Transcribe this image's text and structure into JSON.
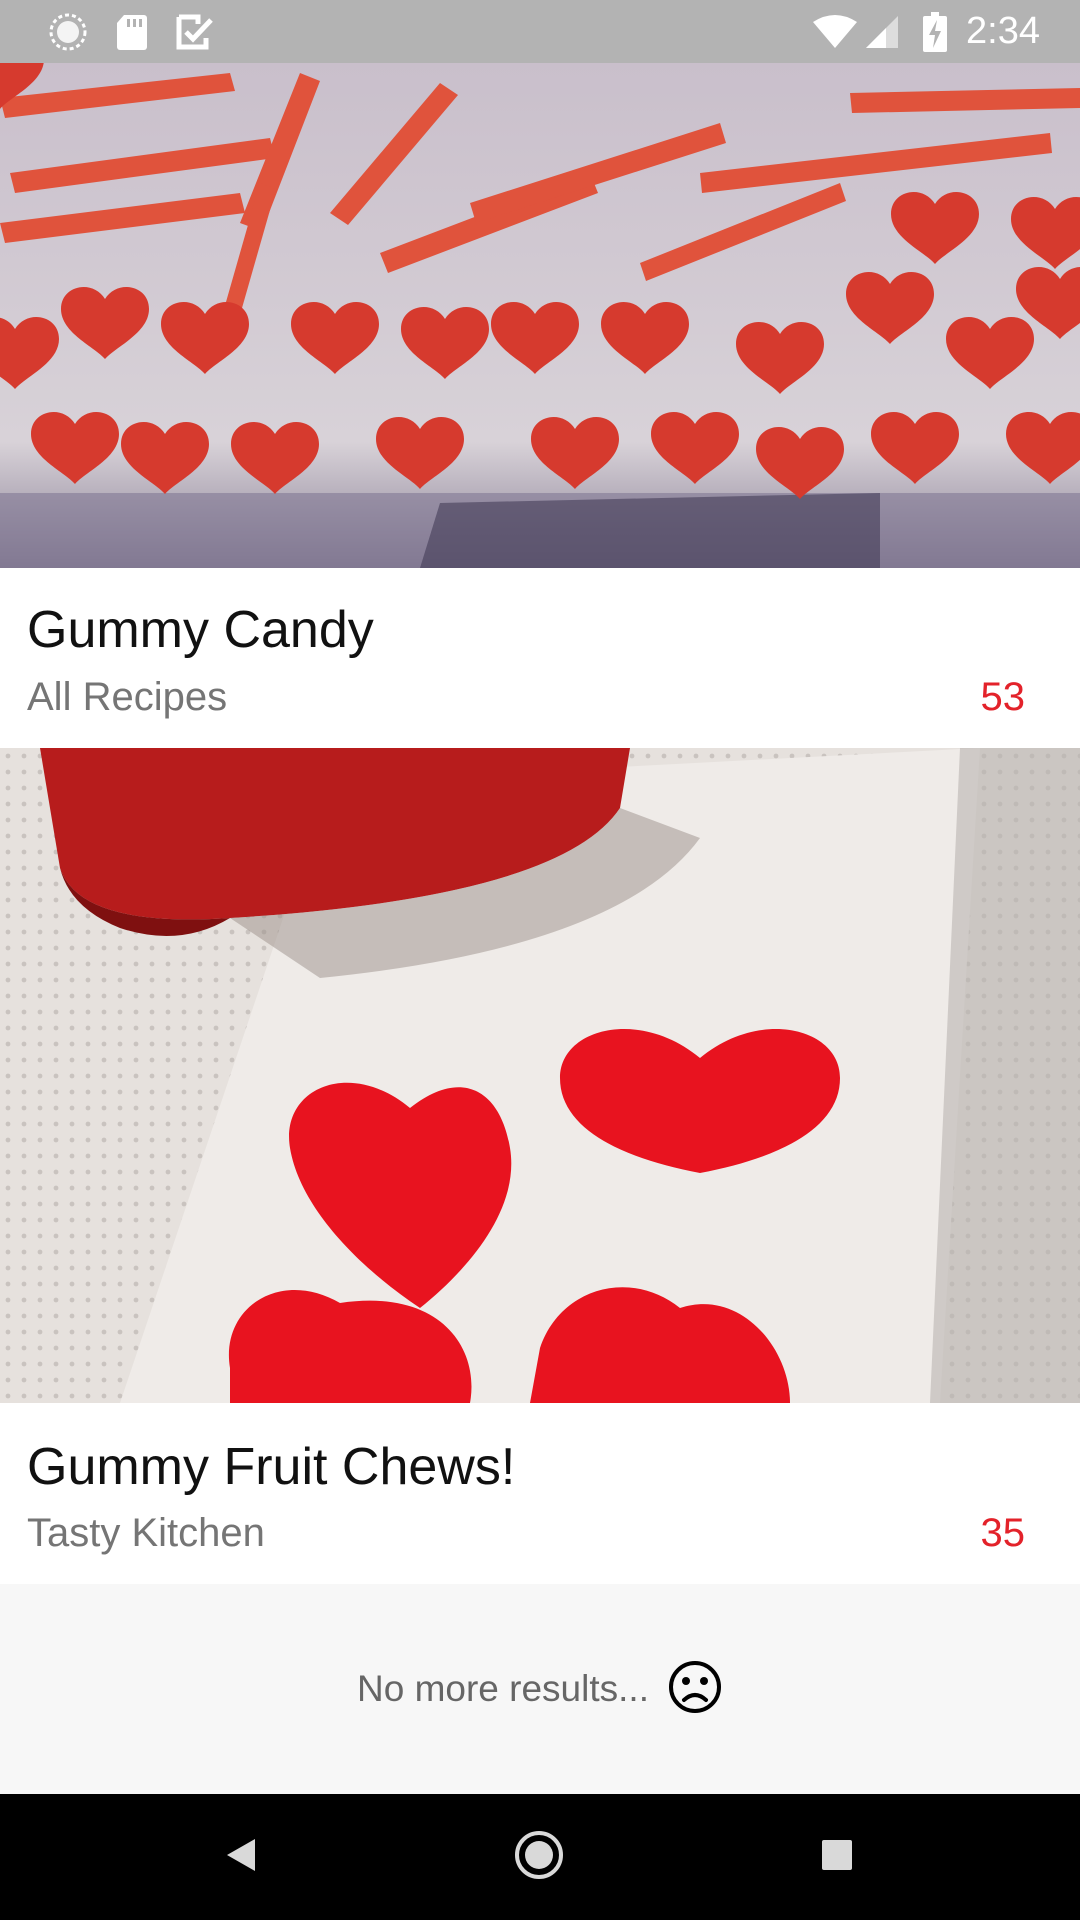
{
  "status_bar": {
    "time": "2:34",
    "icons_left": [
      "sync-icon",
      "sd-card-icon",
      "task-check-icon"
    ],
    "icons_right": [
      "wifi-icon",
      "signal-icon",
      "battery-charging-icon"
    ]
  },
  "recipes": [
    {
      "title": "Gummy Candy",
      "source": "All Recipes",
      "count": "53",
      "image": "red-gummy-hearts-and-strips-photo"
    },
    {
      "title": "Gummy Fruit Chews!",
      "source": "Tasty Kitchen",
      "count": "35",
      "image": "red-gummy-hearts-on-paper-towel-photo"
    }
  ],
  "footer": {
    "no_more_text": "No more results...",
    "icon": "sad-face-icon"
  },
  "nav_bar": {
    "buttons": [
      "back-icon",
      "home-icon",
      "recents-icon"
    ]
  },
  "colors": {
    "accent": "#e3222a",
    "status_bar": "#b3b3b3",
    "nav_bar": "#000000",
    "background": "#f7f7f7"
  }
}
